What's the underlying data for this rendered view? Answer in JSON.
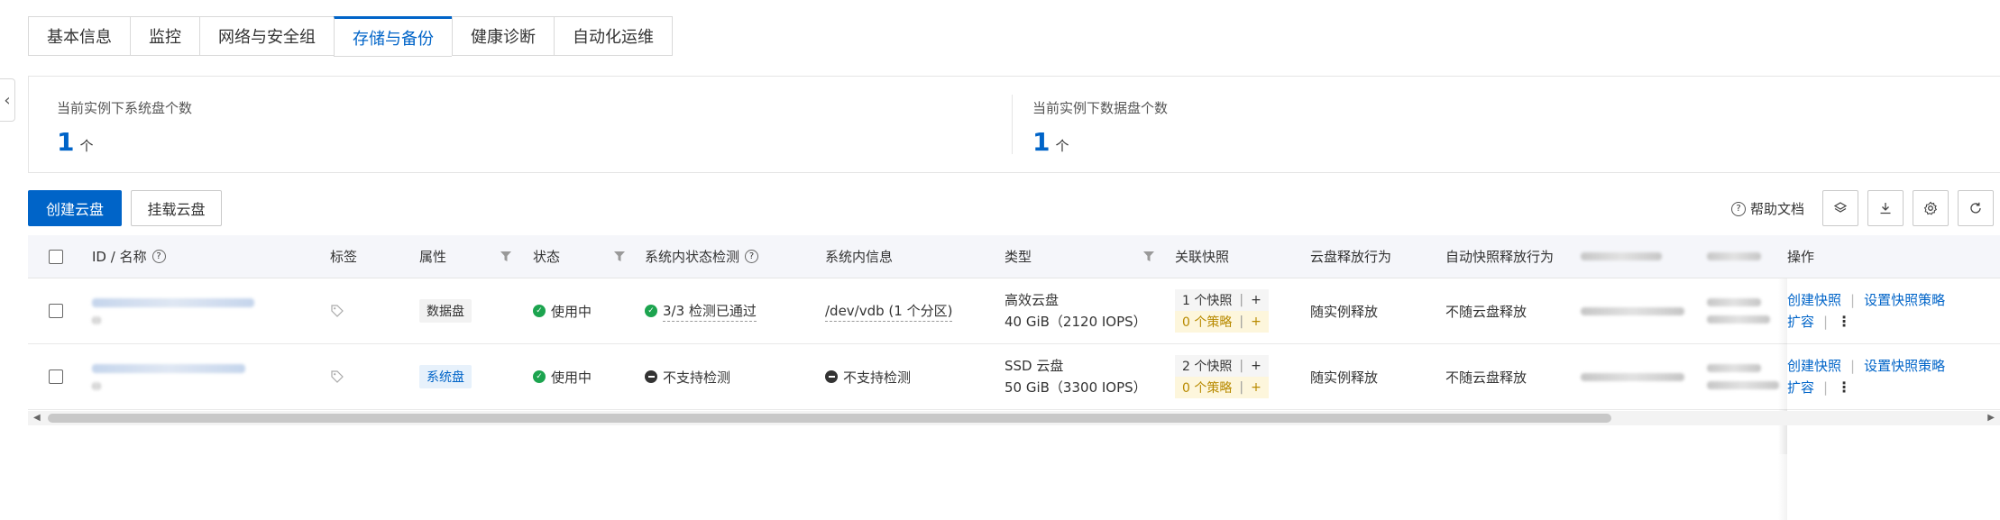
{
  "tabs": [
    "基本信息",
    "监控",
    "网络与安全组",
    "存储与备份",
    "健康诊断",
    "自动化运维"
  ],
  "active_tab": 3,
  "summary": {
    "system_disk_label": "当前实例下系统盘个数",
    "system_disk_count": "1",
    "data_disk_label": "当前实例下数据盘个数",
    "data_disk_count": "1",
    "unit": "个"
  },
  "toolbar": {
    "create_disk": "创建云盘",
    "mount_disk": "挂载云盘",
    "help_doc": "帮助文档"
  },
  "columns": {
    "id_name": "ID / 名称",
    "tags": "标签",
    "attribute": "属性",
    "status": "状态",
    "in_system_check": "系统内状态检测",
    "in_system_info": "系统内信息",
    "type": "类型",
    "snapshots": "关联快照",
    "disk_release": "云盘释放行为",
    "auto_snapshot_release": "自动快照释放行为",
    "operations": "操作"
  },
  "rows": [
    {
      "attribute": "数据盘",
      "status": "使用中",
      "check": "3/3 检测已通过",
      "check_state": "ok",
      "info": "/dev/vdb (1 个分区)",
      "type_name": "高效云盘",
      "type_spec": "40 GiB（2120 IOPS）",
      "snapshot_count": "1 个快照",
      "policy_count": "0 个策略",
      "disk_release": "随实例释放",
      "auto_snapshot_release": "不随云盘释放",
      "op_create_snapshot": "创建快照",
      "op_set_policy": "设置快照策略",
      "op_expand": "扩容"
    },
    {
      "attribute": "系统盘",
      "status": "使用中",
      "check": "不支持检测",
      "check_state": "na",
      "info": "不支持检测",
      "type_name": "SSD 云盘",
      "type_spec": "50 GiB（3300 IOPS）",
      "snapshot_count": "2 个快照",
      "policy_count": "0 个策略",
      "disk_release": "随实例释放",
      "auto_snapshot_release": "不随云盘释放",
      "op_create_snapshot": "创建快照",
      "op_set_policy": "设置快照策略",
      "op_expand": "扩容"
    }
  ],
  "colors": {
    "primary": "#0064c8",
    "success": "#1ca44f",
    "policy_bg": "#fdf6dc"
  },
  "icons": [
    "chevron-left-icon",
    "help-icon",
    "layers-icon",
    "download-icon",
    "gear-icon",
    "refresh-icon",
    "filter-icon",
    "tag-icon",
    "check-circle-icon",
    "minus-circle-icon",
    "more-vertical-icon",
    "plus-icon"
  ]
}
